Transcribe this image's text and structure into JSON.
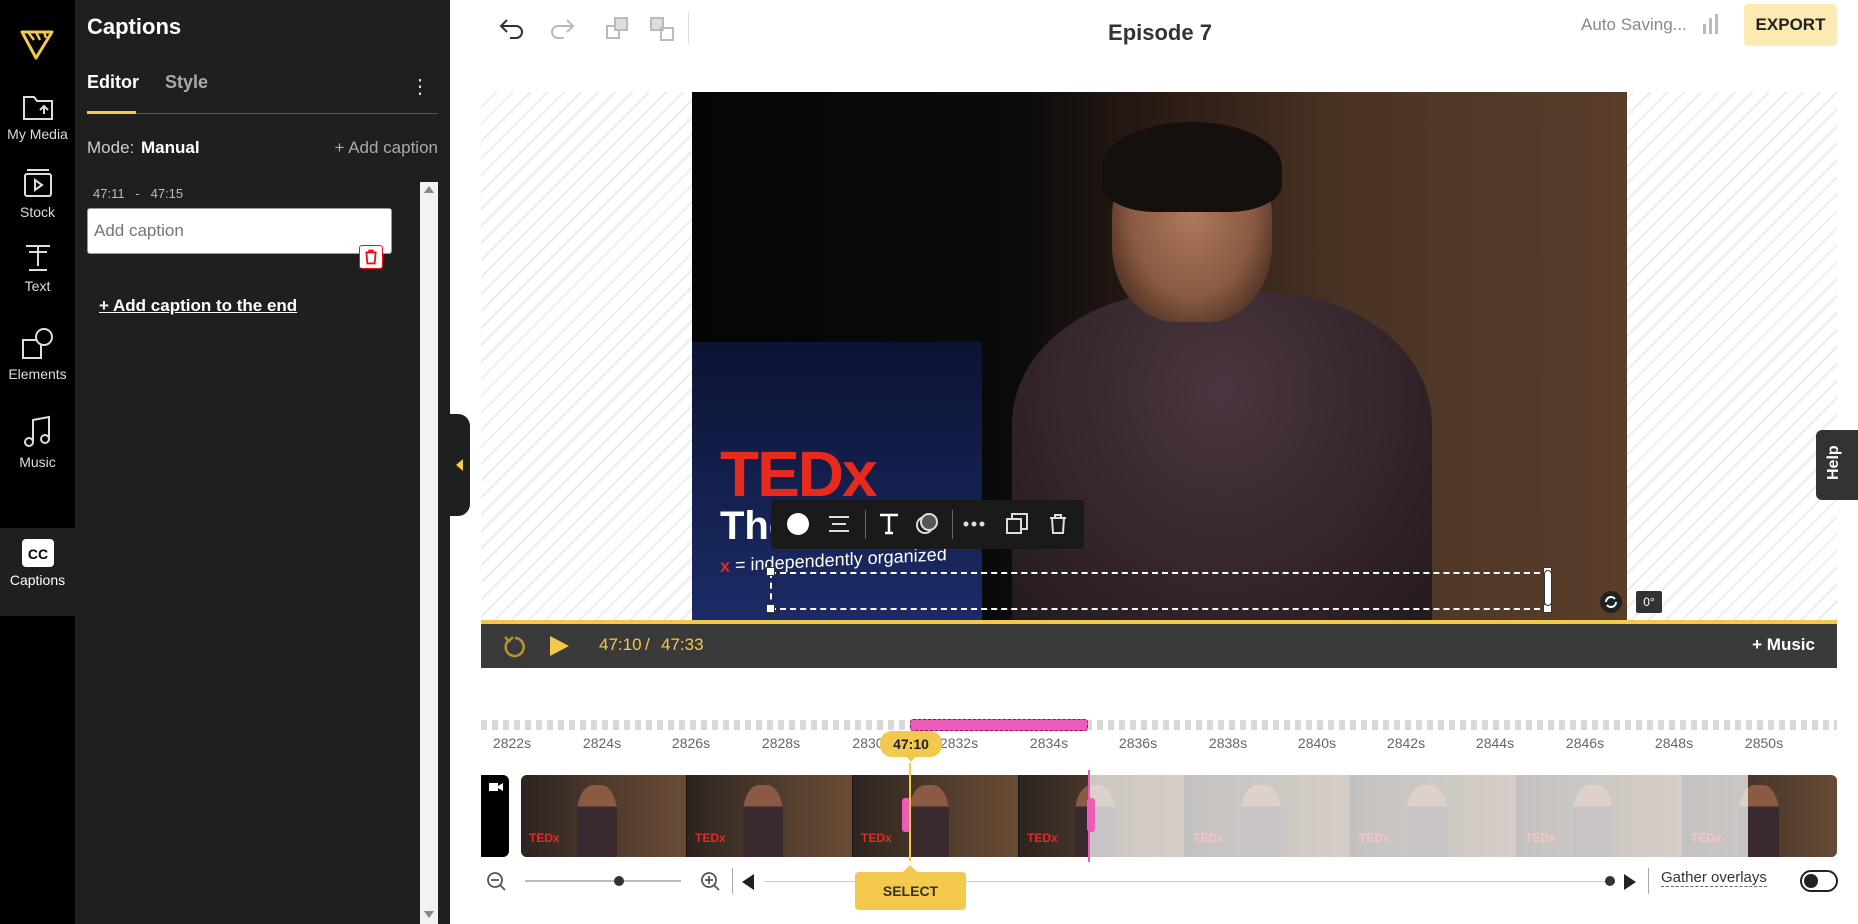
{
  "rail": {
    "items": [
      {
        "label": "My Media",
        "icon": "folder-upload-icon"
      },
      {
        "label": "Stock",
        "icon": "film-play-icon"
      },
      {
        "label": "Text",
        "icon": "text-icon"
      },
      {
        "label": "Elements",
        "icon": "shapes-icon"
      },
      {
        "label": "Music",
        "icon": "music-note-icon"
      },
      {
        "label": "Captions",
        "icon": "cc-icon",
        "active": true
      }
    ]
  },
  "panel": {
    "title": "Captions",
    "tabs": [
      "Editor",
      "Style"
    ],
    "active_tab": "Editor",
    "mode_label": "Mode:",
    "mode_value": "Manual",
    "add_caption": "+ Add caption",
    "caption": {
      "start": "47:11",
      "sep": "-",
      "end": "47:15",
      "placeholder": "Add caption"
    },
    "add_caption_end": "+ Add caption to the end"
  },
  "topbar": {
    "title": "Episode 7",
    "status": "Auto Saving...",
    "export": "EXPORT"
  },
  "video": {
    "tedx_logo": "TEDx",
    "tedx_the": "The",
    "tedx_tag_x": "x",
    "tedx_tag": "= independently organized",
    "rotation": "0°"
  },
  "help": "Help",
  "playback": {
    "current": "47:10",
    "sep": "/",
    "total": "47:33",
    "music": "+ Music"
  },
  "timeline": {
    "ticks": [
      "2822s",
      "2824s",
      "2826s",
      "2828s",
      "2830",
      "2832s",
      "2834s",
      "2836s",
      "2838s",
      "2840s",
      "2842s",
      "2844s",
      "2846s",
      "2848s",
      "2850s"
    ],
    "playhead": "47:10",
    "thumb_logo": "TEDx",
    "select": "SELECT",
    "gather_overlays": "Gather overlays"
  },
  "colors": {
    "accent": "#f2c94c",
    "selection": "#ee5bb9",
    "tedx_red": "#e62b1e",
    "panel_bg": "#1f1f1f"
  }
}
